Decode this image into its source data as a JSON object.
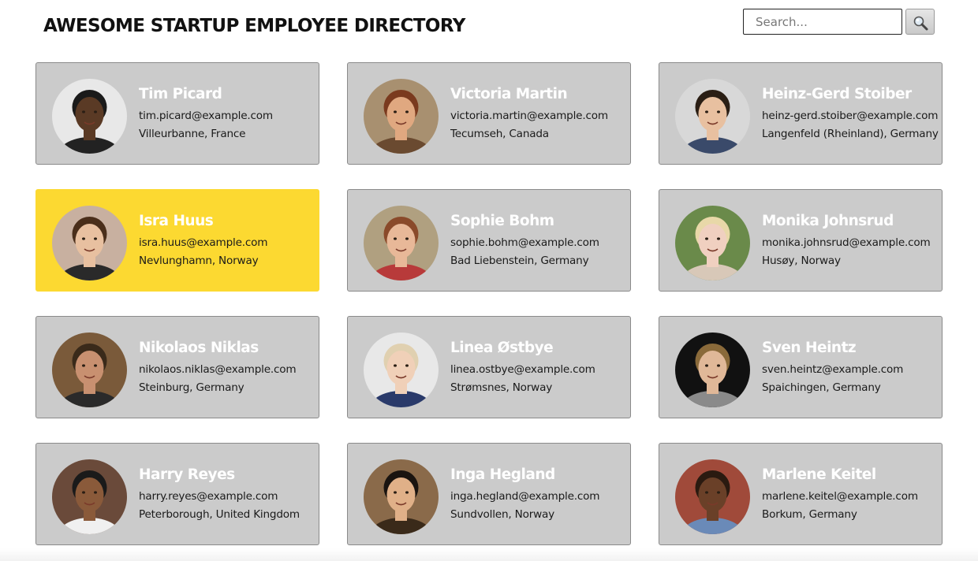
{
  "header": {
    "title": "AWESOME STARTUP EMPLOYEE DIRECTORY",
    "search_placeholder": "Search...",
    "search_icon": "magnifier-icon"
  },
  "colors": {
    "card_background": "#cbcbcb",
    "card_selected_background": "#fcd931",
    "card_border": "#8a8a8a",
    "name_color": "#ffffff"
  },
  "employees": [
    {
      "name": "Tim Picard",
      "email": "tim.picard@example.com",
      "location": "Villeurbanne, France",
      "selected": false,
      "skin": "#5a3a25",
      "hair": "#1a1a1a",
      "bg": "#e8e8e8",
      "shirt": "#222222"
    },
    {
      "name": "Victoria Martin",
      "email": "victoria.martin@example.com",
      "location": "Tecumseh, Canada",
      "selected": false,
      "skin": "#e0a880",
      "hair": "#7a3a1e",
      "bg": "#a89070",
      "shirt": "#6a4a30"
    },
    {
      "name": "Heinz-Gerd Stoiber",
      "email": "heinz-gerd.stoiber@example.com",
      "location": "Langenfeld (Rheinland), Germany",
      "selected": false,
      "skin": "#e8c0a0",
      "hair": "#2a1e14",
      "bg": "#d8d8d8",
      "shirt": "#3a4a6a"
    },
    {
      "name": "Isra Huus",
      "email": "isra.huus@example.com",
      "location": "Nevlunghamn, Norway",
      "selected": true,
      "skin": "#e8c0a0",
      "hair": "#4a2e1a",
      "bg": "#c8b0a0",
      "shirt": "#2a2a2a"
    },
    {
      "name": "Sophie Bohm",
      "email": "sophie.bohm@example.com",
      "location": "Bad Liebenstein, Germany",
      "selected": false,
      "skin": "#e8b898",
      "hair": "#8a4a2a",
      "bg": "#b0a080",
      "shirt": "#b83a3a"
    },
    {
      "name": "Monika Johnsrud",
      "email": "monika.johnsrud@example.com",
      "location": "Husøy, Norway",
      "selected": false,
      "skin": "#f0d0c0",
      "hair": "#e8d8a8",
      "bg": "#6a8a4a",
      "shirt": "#d8c8b8"
    },
    {
      "name": "Nikolaos Niklas",
      "email": "nikolaos.niklas@example.com",
      "location": "Steinburg, Germany",
      "selected": false,
      "skin": "#c89070",
      "hair": "#3a2a1a",
      "bg": "#7a5a3a",
      "shirt": "#2a2a2a"
    },
    {
      "name": "Linea Østbye",
      "email": "linea.ostbye@example.com",
      "location": "Strømsnes, Norway",
      "selected": false,
      "skin": "#f0d0b8",
      "hair": "#e0d0b0",
      "bg": "#e8e8e8",
      "shirt": "#2a3a6a"
    },
    {
      "name": "Sven Heintz",
      "email": "sven.heintz@example.com",
      "location": "Spaichingen, Germany",
      "selected": false,
      "skin": "#e0b898",
      "hair": "#8a6a3a",
      "bg": "#111111",
      "shirt": "#8a8a8a"
    },
    {
      "name": "Harry Reyes",
      "email": "harry.reyes@example.com",
      "location": "Peterborough, United Kingdom",
      "selected": false,
      "skin": "#8a5a3a",
      "hair": "#1a1a1a",
      "bg": "#6a4a3a",
      "shirt": "#f0f0f0"
    },
    {
      "name": "Inga Hegland",
      "email": "inga.hegland@example.com",
      "location": "Sundvollen, Norway",
      "selected": false,
      "skin": "#e0b088",
      "hair": "#1a1410",
      "bg": "#8a6a4a",
      "shirt": "#3a2a1a"
    },
    {
      "name": "Marlene Keitel",
      "email": "marlene.keitel@example.com",
      "location": "Borkum, Germany",
      "selected": false,
      "skin": "#6a4028",
      "hair": "#2a1a10",
      "bg": "#a04a3a",
      "shirt": "#6a8ab8"
    }
  ]
}
